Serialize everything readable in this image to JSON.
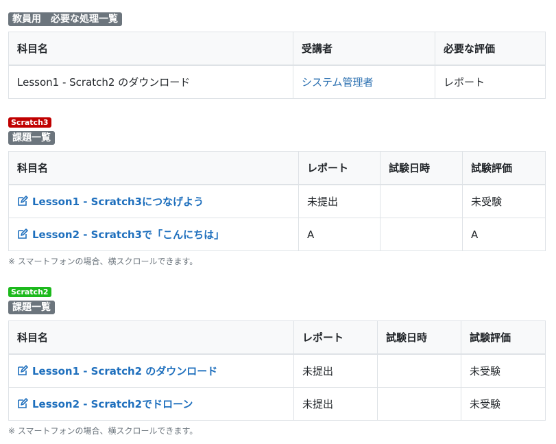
{
  "teacher": {
    "badge": "教員用　必要な処理一覧",
    "headers": [
      "科目名",
      "受講者",
      "必要な評価"
    ],
    "row": {
      "subject": "Lesson1 - Scratch2 のダウンロード",
      "student": "システム管理者",
      "evaluation": "レポート"
    }
  },
  "scratch3": {
    "tag": "Scratch3",
    "badge": "課題一覧",
    "headers": [
      "科目名",
      "レポート",
      "試験日時",
      "試験評価"
    ],
    "rows": [
      {
        "subject": "Lesson1 - Scratch3につなげよう",
        "report": "未提出",
        "exam_date": "",
        "exam_eval": "未受験"
      },
      {
        "subject": "Lesson2 - Scratch3で「こんにちは」",
        "report": "A",
        "exam_date": "",
        "exam_eval": "A"
      }
    ],
    "note": "※ スマートフォンの場合、横スクロールできます。"
  },
  "scratch2": {
    "tag": "Scratch2",
    "badge": "課題一覧",
    "headers": [
      "科目名",
      "レポート",
      "試験日時",
      "試験評価"
    ],
    "rows": [
      {
        "subject": "Lesson1 - Scratch2 のダウンロード",
        "report": "未提出",
        "exam_date": "",
        "exam_eval": "未受験"
      },
      {
        "subject": "Lesson2 - Scratch2でドローン",
        "report": "未提出",
        "exam_date": "",
        "exam_eval": "未受験"
      }
    ],
    "note": "※ スマートフォンの場合、横スクロールできます。"
  },
  "colors": {
    "link": "#1e6fbd",
    "badge_gray": "#6c757d",
    "tag_scratch3": "#c00000",
    "tag_scratch2": "#1cb91c"
  },
  "icons": {
    "edit": "edit-icon"
  }
}
